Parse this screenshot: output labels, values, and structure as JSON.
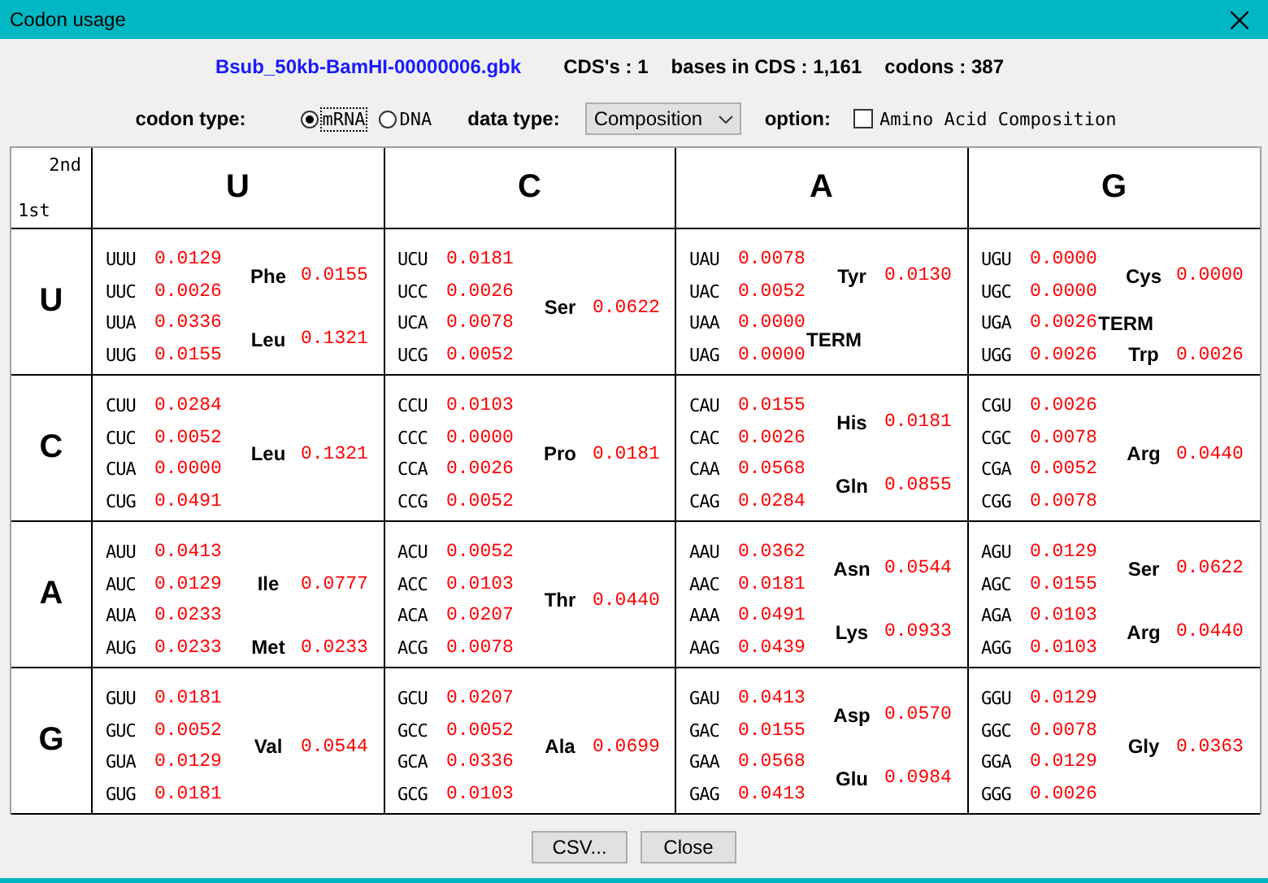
{
  "window": {
    "title": "Codon usage"
  },
  "summary": {
    "file": "Bsub_50kb-BamHI-00000006.gbk",
    "stats": [
      "CDS's : 1",
      "bases in CDS : 1,161",
      "codons : 387"
    ]
  },
  "options": {
    "codon_type": {
      "label": "codon type:",
      "choices": [
        {
          "label": "mRNA",
          "selected": true
        },
        {
          "label": "DNA",
          "selected": false
        }
      ]
    },
    "data_type": {
      "label": "data type:",
      "value": "Composition"
    },
    "option": {
      "label": "option:",
      "checkbox": {
        "label": "Amino Acid Composition",
        "checked": false
      }
    }
  },
  "table": {
    "corner": {
      "top": "2nd",
      "bottom": "1st"
    },
    "columns": [
      "U",
      "C",
      "A",
      "G"
    ],
    "rows": [
      {
        "header": "U",
        "cells": [
          {
            "groups": [
              {
                "amino": "Phe",
                "value": "0.0155",
                "codons": [
                  {
                    "codon": "UUU",
                    "value": "0.0129"
                  },
                  {
                    "codon": "UUC",
                    "value": "0.0026"
                  }
                ]
              },
              {
                "amino": "Leu",
                "value": "0.1321",
                "codons": [
                  {
                    "codon": "UUA",
                    "value": "0.0336"
                  },
                  {
                    "codon": "UUG",
                    "value": "0.0155"
                  }
                ]
              }
            ]
          },
          {
            "groups": [
              {
                "amino": "Ser",
                "value": "0.0622",
                "codons": [
                  {
                    "codon": "UCU",
                    "value": "0.0181"
                  },
                  {
                    "codon": "UCC",
                    "value": "0.0026"
                  },
                  {
                    "codon": "UCA",
                    "value": "0.0078"
                  },
                  {
                    "codon": "UCG",
                    "value": "0.0052"
                  }
                ]
              }
            ]
          },
          {
            "groups": [
              {
                "amino": "Tyr",
                "value": "0.0130",
                "codons": [
                  {
                    "codon": "UAU",
                    "value": "0.0078"
                  },
                  {
                    "codon": "UAC",
                    "value": "0.0052"
                  }
                ]
              },
              {
                "amino": "TERM",
                "codons": [
                  {
                    "codon": "UAA",
                    "value": "0.0000"
                  },
                  {
                    "codon": "UAG",
                    "value": "0.0000"
                  }
                ]
              }
            ]
          },
          {
            "groups": [
              {
                "amino": "Cys",
                "value": "0.0000",
                "codons": [
                  {
                    "codon": "UGU",
                    "value": "0.0000"
                  },
                  {
                    "codon": "UGC",
                    "value": "0.0000"
                  }
                ]
              },
              {
                "amino": "TERM",
                "codons": [
                  {
                    "codon": "UGA",
                    "value": "0.0026"
                  }
                ]
              },
              {
                "amino": "Trp",
                "value": "0.0026",
                "codons": [
                  {
                    "codon": "UGG",
                    "value": "0.0026"
                  }
                ]
              }
            ]
          }
        ]
      },
      {
        "header": "C",
        "cells": [
          {
            "groups": [
              {
                "amino": "Leu",
                "value": "0.1321",
                "codons": [
                  {
                    "codon": "CUU",
                    "value": "0.0284"
                  },
                  {
                    "codon": "CUC",
                    "value": "0.0052"
                  },
                  {
                    "codon": "CUA",
                    "value": "0.0000"
                  },
                  {
                    "codon": "CUG",
                    "value": "0.0491"
                  }
                ]
              }
            ]
          },
          {
            "groups": [
              {
                "amino": "Pro",
                "value": "0.0181",
                "codons": [
                  {
                    "codon": "CCU",
                    "value": "0.0103"
                  },
                  {
                    "codon": "CCC",
                    "value": "0.0000"
                  },
                  {
                    "codon": "CCA",
                    "value": "0.0026"
                  },
                  {
                    "codon": "CCG",
                    "value": "0.0052"
                  }
                ]
              }
            ]
          },
          {
            "groups": [
              {
                "amino": "His",
                "value": "0.0181",
                "codons": [
                  {
                    "codon": "CAU",
                    "value": "0.0155"
                  },
                  {
                    "codon": "CAC",
                    "value": "0.0026"
                  }
                ]
              },
              {
                "amino": "Gln",
                "value": "0.0855",
                "codons": [
                  {
                    "codon": "CAA",
                    "value": "0.0568"
                  },
                  {
                    "codon": "CAG",
                    "value": "0.0284"
                  }
                ]
              }
            ]
          },
          {
            "groups": [
              {
                "amino": "Arg",
                "value": "0.0440",
                "codons": [
                  {
                    "codon": "CGU",
                    "value": "0.0026"
                  },
                  {
                    "codon": "CGC",
                    "value": "0.0078"
                  },
                  {
                    "codon": "CGA",
                    "value": "0.0052"
                  },
                  {
                    "codon": "CGG",
                    "value": "0.0078"
                  }
                ]
              }
            ]
          }
        ]
      },
      {
        "header": "A",
        "cells": [
          {
            "groups": [
              {
                "amino": "Ile",
                "value": "0.0777",
                "codons": [
                  {
                    "codon": "AUU",
                    "value": "0.0413"
                  },
                  {
                    "codon": "AUC",
                    "value": "0.0129"
                  },
                  {
                    "codon": "AUA",
                    "value": "0.0233"
                  }
                ]
              },
              {
                "amino": "Met",
                "value": "0.0233",
                "codons": [
                  {
                    "codon": "AUG",
                    "value": "0.0233"
                  }
                ]
              }
            ]
          },
          {
            "groups": [
              {
                "amino": "Thr",
                "value": "0.0440",
                "codons": [
                  {
                    "codon": "ACU",
                    "value": "0.0052"
                  },
                  {
                    "codon": "ACC",
                    "value": "0.0103"
                  },
                  {
                    "codon": "ACA",
                    "value": "0.0207"
                  },
                  {
                    "codon": "ACG",
                    "value": "0.0078"
                  }
                ]
              }
            ]
          },
          {
            "groups": [
              {
                "amino": "Asn",
                "value": "0.0544",
                "codons": [
                  {
                    "codon": "AAU",
                    "value": "0.0362"
                  },
                  {
                    "codon": "AAC",
                    "value": "0.0181"
                  }
                ]
              },
              {
                "amino": "Lys",
                "value": "0.0933",
                "codons": [
                  {
                    "codon": "AAA",
                    "value": "0.0491"
                  },
                  {
                    "codon": "AAG",
                    "value": "0.0439"
                  }
                ]
              }
            ]
          },
          {
            "groups": [
              {
                "amino": "Ser",
                "value": "0.0622",
                "codons": [
                  {
                    "codon": "AGU",
                    "value": "0.0129"
                  },
                  {
                    "codon": "AGC",
                    "value": "0.0155"
                  }
                ]
              },
              {
                "amino": "Arg",
                "value": "0.0440",
                "codons": [
                  {
                    "codon": "AGA",
                    "value": "0.0103"
                  },
                  {
                    "codon": "AGG",
                    "value": "0.0103"
                  }
                ]
              }
            ]
          }
        ]
      },
      {
        "header": "G",
        "cells": [
          {
            "groups": [
              {
                "amino": "Val",
                "value": "0.0544",
                "codons": [
                  {
                    "codon": "GUU",
                    "value": "0.0181"
                  },
                  {
                    "codon": "GUC",
                    "value": "0.0052"
                  },
                  {
                    "codon": "GUA",
                    "value": "0.0129"
                  },
                  {
                    "codon": "GUG",
                    "value": "0.0181"
                  }
                ]
              }
            ]
          },
          {
            "groups": [
              {
                "amino": "Ala",
                "value": "0.0699",
                "codons": [
                  {
                    "codon": "GCU",
                    "value": "0.0207"
                  },
                  {
                    "codon": "GCC",
                    "value": "0.0052"
                  },
                  {
                    "codon": "GCA",
                    "value": "0.0336"
                  },
                  {
                    "codon": "GCG",
                    "value": "0.0103"
                  }
                ]
              }
            ]
          },
          {
            "groups": [
              {
                "amino": "Asp",
                "value": "0.0570",
                "codons": [
                  {
                    "codon": "GAU",
                    "value": "0.0413"
                  },
                  {
                    "codon": "GAC",
                    "value": "0.0155"
                  }
                ]
              },
              {
                "amino": "Glu",
                "value": "0.0984",
                "codons": [
                  {
                    "codon": "GAA",
                    "value": "0.0568"
                  },
                  {
                    "codon": "GAG",
                    "value": "0.0413"
                  }
                ]
              }
            ]
          },
          {
            "groups": [
              {
                "amino": "Gly",
                "value": "0.0363",
                "codons": [
                  {
                    "codon": "GGU",
                    "value": "0.0129"
                  },
                  {
                    "codon": "GGC",
                    "value": "0.0078"
                  },
                  {
                    "codon": "GGA",
                    "value": "0.0129"
                  },
                  {
                    "codon": "GGG",
                    "value": "0.0026"
                  }
                ]
              }
            ]
          }
        ]
      }
    ]
  },
  "buttons": [
    "CSV...",
    "Close"
  ]
}
